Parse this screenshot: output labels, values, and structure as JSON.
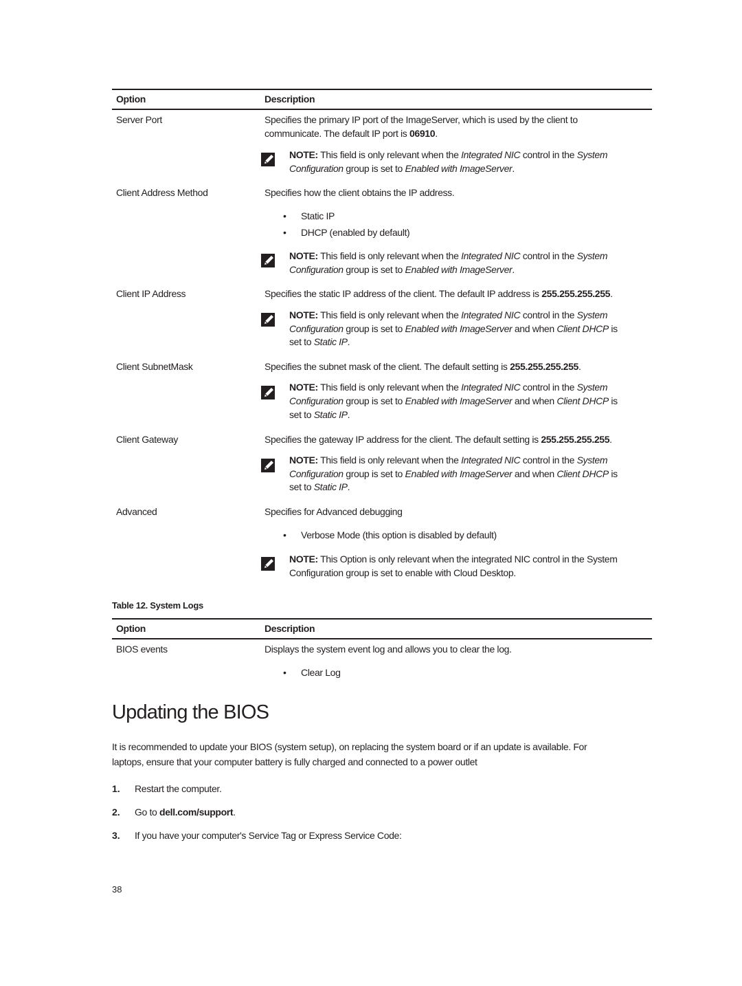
{
  "table_continued": {
    "headers": {
      "option": "Option",
      "description": "Description"
    },
    "rows": [
      {
        "option": "Server Port",
        "description_lines": [
          "Specifies the primary IP port of the ImageServer, which is used by the client to",
          "communicate. The default IP port is "
        ],
        "default_value": "06910",
        "note": {
          "label": "NOTE:",
          "parts": [
            "This field is only relevant when the ",
            "Integrated NIC",
            " control in the ",
            "System"
          ],
          "line2": [
            "Configuration",
            " group is set to ",
            "Enabled with ImageServer",
            "."
          ]
        }
      },
      {
        "option": "Client Address Method",
        "description": "Specifies how the client obtains the IP address.",
        "bullets": [
          "Static IP",
          "DHCP (enabled by default)"
        ],
        "note": {
          "label": "NOTE:",
          "parts": [
            "This field is only relevant when the ",
            "Integrated NIC",
            " control in the ",
            "System"
          ],
          "line2": [
            "Configuration",
            " group is set to ",
            "Enabled with ImageServer",
            "."
          ]
        }
      },
      {
        "option": "Client IP Address",
        "description": "Specifies the static IP address of the client. The default IP address is ",
        "default_value": "255.255.255.255",
        "note": {
          "label": "NOTE:",
          "parts": [
            "This field is only relevant when the ",
            "Integrated NIC",
            " control in the ",
            "System"
          ],
          "line2": [
            "Configuration",
            " group is set to ",
            "Enabled with ImageServer",
            " and when ",
            "Client DHCP",
            " is"
          ],
          "line3": [
            "set to ",
            "Static IP",
            "."
          ]
        }
      },
      {
        "option": "Client SubnetMask",
        "description": "Specifies the subnet mask of the client. The default setting is ",
        "default_value": "255.255.255.255",
        "note": {
          "label": "NOTE:",
          "parts": [
            "This field is only relevant when the ",
            "Integrated NIC",
            " control in the ",
            "System"
          ],
          "line2": [
            "Configuration",
            " group is set to ",
            "Enabled with ImageServer",
            " and when ",
            "Client DHCP",
            " is"
          ],
          "line3": [
            "set to ",
            "Static IP",
            "."
          ]
        }
      },
      {
        "option": "Client Gateway",
        "description": "Specifies the gateway IP address for the client. The default setting is ",
        "default_value": "255.255.255.255",
        "note": {
          "label": "NOTE:",
          "parts": [
            "This field is only relevant when the ",
            "Integrated NIC",
            " control in the ",
            "System"
          ],
          "line2": [
            "Configuration",
            " group is set to ",
            "Enabled with ImageServer",
            " and when ",
            "Client DHCP",
            " is"
          ],
          "line3": [
            "set to ",
            "Static IP",
            "."
          ]
        }
      },
      {
        "option": "Advanced",
        "description": "Specifies for Advanced debugging",
        "bullets": [
          "Verbose Mode (this option is disabled by default)"
        ],
        "note": {
          "label": "NOTE:",
          "line1": "This Option is only relevant when the integrated NIC control in the System",
          "line2": "Configuration group is set to enable with Cloud Desktop."
        }
      }
    ]
  },
  "table_12": {
    "caption": "Table 12. System Logs",
    "headers": {
      "option": "Option",
      "description": "Description"
    },
    "rows": [
      {
        "option": "BIOS events",
        "description": "Displays the system event log and allows you to clear the log.",
        "bullets": [
          "Clear Log"
        ]
      }
    ]
  },
  "section": {
    "title": "Updating the BIOS",
    "intro_lines": [
      "It is recommended to update your BIOS (system setup), on replacing the system board or if an update is available. For",
      "laptops, ensure that your computer battery is fully charged and connected to a power outlet"
    ],
    "steps": [
      {
        "num": "1.",
        "text": "Restart the computer."
      },
      {
        "num": "2.",
        "text_before": "Go to ",
        "link": "dell.com/support",
        "text_after": "."
      },
      {
        "num": "3.",
        "text": "If you have your computer's Service Tag or Express Service Code:"
      }
    ]
  },
  "footer": {
    "page_number": "38"
  },
  "icons": {
    "note": "pencil-note-icon",
    "bullet": "•"
  }
}
